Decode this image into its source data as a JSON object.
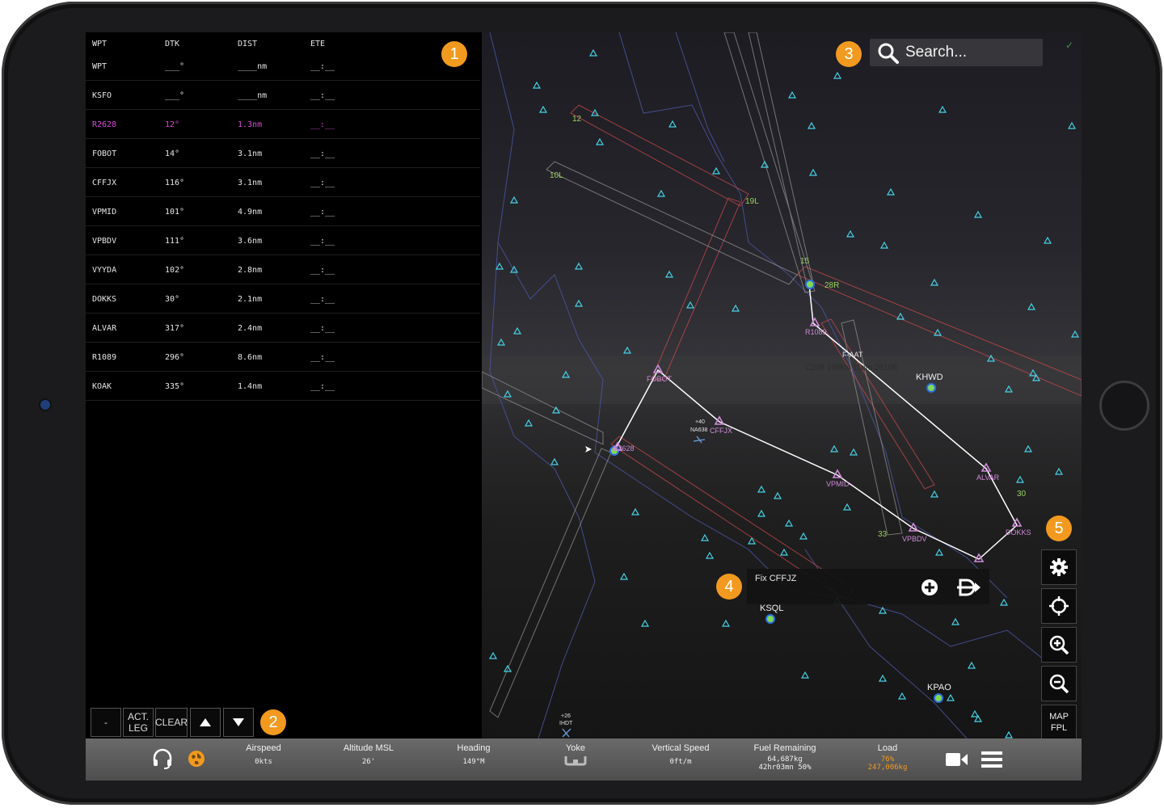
{
  "flight_plan": {
    "headers": {
      "wpt": "WPT",
      "dtk": "DTK",
      "dist": "DIST",
      "ete": "ETE"
    },
    "rows": [
      {
        "wpt": "WPT",
        "dtk": "___°",
        "dist": "____nm",
        "ete": "__:__"
      },
      {
        "wpt": "KSFO",
        "dtk": "___°",
        "dist": "____nm",
        "ete": "__:__"
      },
      {
        "wpt": "R2628",
        "dtk": "12°",
        "dist": "1.3nm",
        "ete": "__:__"
      },
      {
        "wpt": "FOBOT",
        "dtk": "14°",
        "dist": "3.1nm",
        "ete": "__:__"
      },
      {
        "wpt": "CFFJX",
        "dtk": "116°",
        "dist": "3.1nm",
        "ete": "__:__"
      },
      {
        "wpt": "VPMID",
        "dtk": "101°",
        "dist": "4.9nm",
        "ete": "__:__"
      },
      {
        "wpt": "VPBDV",
        "dtk": "111°",
        "dist": "3.6nm",
        "ete": "__:__"
      },
      {
        "wpt": "VYYDA",
        "dtk": "102°",
        "dist": "2.8nm",
        "ete": "__:__"
      },
      {
        "wpt": "DOKKS",
        "dtk": "30°",
        "dist": "2.1nm",
        "ete": "__:__"
      },
      {
        "wpt": "ALVAR",
        "dtk": "317°",
        "dist": "2.4nm",
        "ete": "__:__"
      },
      {
        "wpt": "R1089",
        "dtk": "296°",
        "dist": "8.6nm",
        "ete": "__:__"
      },
      {
        "wpt": "KOAK",
        "dtk": "335°",
        "dist": "1.4nm",
        "ete": "__:__"
      }
    ],
    "active_row_color": "#d84ad8"
  },
  "controls": {
    "dash": "-",
    "act_leg_1": "ACT.",
    "act_leg_2": "LEG",
    "clear": "CLEAR",
    "up_icon": "triangle-up-icon",
    "down_icon": "triangle-down-icon"
  },
  "callouts": {
    "one": "1",
    "two": "2",
    "three": "3",
    "four": "4",
    "five": "5",
    "color": "#f29a1f"
  },
  "search": {
    "placeholder": "Search..."
  },
  "popup": {
    "label": "Fix CFFJZ",
    "add_icon": "plus-circle-icon",
    "direct_icon": "direct-to-icon"
  },
  "map_buttons": {
    "settings_icon": "gear-icon",
    "center_icon": "crosshair-icon",
    "zoom_in_icon": "zoom-in-icon",
    "zoom_out_icon": "zoom-out-icon",
    "map_fpl_1": "MAP",
    "map_fpl_2": "FPL"
  },
  "map_labels": {
    "khwd": "KHWD",
    "ksql": "KSQL",
    "kpao": "KPAO",
    "fobot": "FOBOT",
    "cffjx": "CFFJX",
    "vpmid": "VPMID",
    "vpbdv": "VPBDV",
    "alvar": "ALVAR",
    "dokks": "DOKKS",
    "r1089": "R1089",
    "r2628": "R2628",
    "traffic_1": "C208 108kts 11nm 2610ft",
    "traffic_1b": "F-AAT",
    "traffic_2a": "+40",
    "traffic_2b": "NA638",
    "traffic_3a": "+26",
    "traffic_3b": "IHDT",
    "rwy_12": "12",
    "rwy_10l": "10L",
    "rwy_19l": "19L",
    "rwy_15": "15",
    "rwy_28r": "28R",
    "rwy_30": "30",
    "rwy_33": "33"
  },
  "status_bar": {
    "headset_icon": "headset-icon",
    "globe_icon": "globe-icon",
    "airspeed_label": "Airspeed",
    "airspeed": "0kts",
    "altitude_label": "Altitude MSL",
    "altitude": "26'",
    "heading_label": "Heading",
    "heading": "149°M",
    "yoke_label": "Yoke",
    "yoke_icon": "yoke-icon",
    "vs_label": "Vertical Speed",
    "vs": "0ft/m",
    "fuel_label": "Fuel Remaining",
    "fuel_1": "64,687kg",
    "fuel_2": "42hr03mn 50%",
    "load_label": "Load",
    "load_1": "76%",
    "load_2": "247,006kg",
    "camera_icon": "video-camera-icon",
    "menu_icon": "hamburger-menu-icon"
  }
}
